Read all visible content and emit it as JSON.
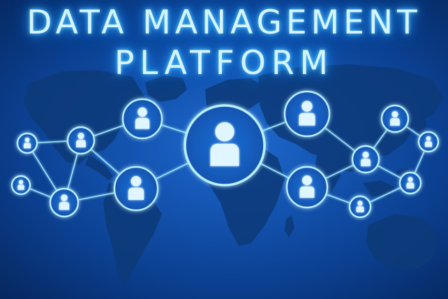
{
  "image": {
    "title_line1": "DATA MANAGEMENT",
    "title_line2": "PLATFORM",
    "colors": {
      "background": "#1455b2",
      "map": "#0d3a78",
      "glow": "#7fe0ff",
      "icon_fill": "#dff6ff"
    }
  }
}
